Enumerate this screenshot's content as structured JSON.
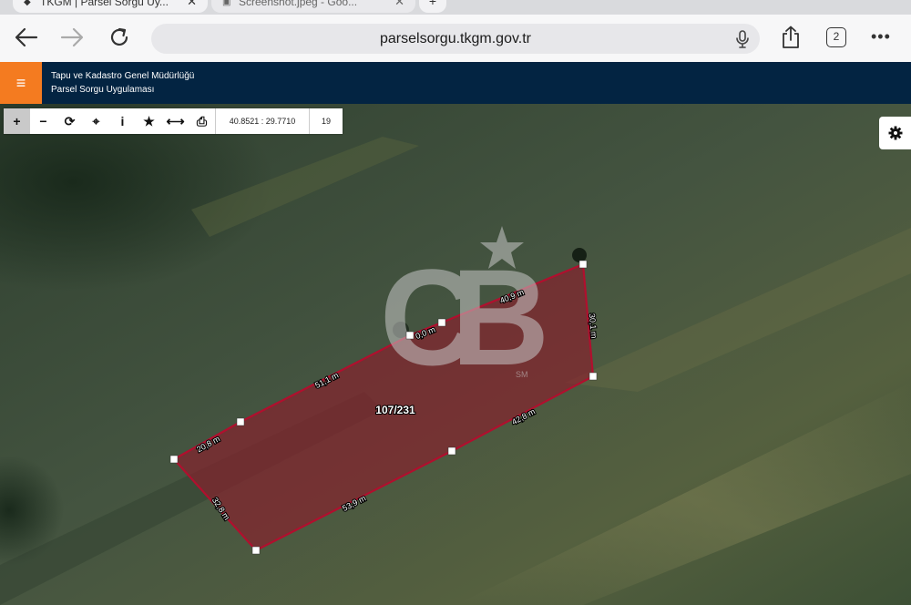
{
  "browser": {
    "tabs": [
      {
        "title": "TKGM | Parsel Sorgu Uy...",
        "active": true
      },
      {
        "title": "Screenshot.jpeg - Goo...",
        "active": false
      }
    ],
    "new_tab_label": "+",
    "url": "parselsorgu.tkgm.gov.tr",
    "tab_count": "2",
    "more_label": "•••"
  },
  "app": {
    "title_line1": "Tapu ve Kadastro Genel Müdürlüğü",
    "title_line2": "Parsel Sorgu Uygulaması",
    "menu_label": "≡"
  },
  "map_toolbar": {
    "zoom_in": "+",
    "zoom_out": "−",
    "refresh": "⟳",
    "locate": "⌖",
    "info": "i",
    "favorite": "★",
    "measure": "⟷",
    "print": "⎙",
    "coordinates": "40.8521 : 29.7710",
    "zoom_level": "19"
  },
  "parcel": {
    "label": "107/231",
    "color": "#b10f2e",
    "edges": [
      "0,0 m",
      "40,9 m",
      "30,1 m",
      "42,8 m",
      "53,9 m",
      "32,8 m",
      "20,8 m",
      "51,1 m"
    ]
  },
  "watermark": {
    "text": "CB",
    "mark": "SM"
  }
}
